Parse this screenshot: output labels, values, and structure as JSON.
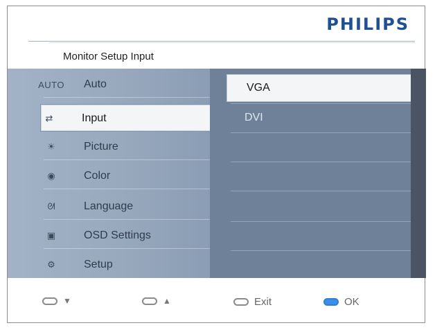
{
  "brand": "PHILIPS",
  "title": "Monitor Setup Input",
  "menu": {
    "items": [
      {
        "label": "Auto",
        "icon": "AUTO",
        "icon_name": "auto-icon"
      },
      {
        "label": "Input",
        "icon": "⇄",
        "icon_name": "input-icon",
        "selected": true
      },
      {
        "label": "Picture",
        "icon": "☀",
        "icon_name": "picture-icon"
      },
      {
        "label": "Color",
        "icon": "◉",
        "icon_name": "color-icon"
      },
      {
        "label": "Language",
        "icon": "ᘛ",
        "icon_name": "language-icon"
      },
      {
        "label": "OSD Settings",
        "icon": "▣",
        "icon_name": "osd-settings-icon"
      },
      {
        "label": "Setup",
        "icon": "⚙",
        "icon_name": "setup-icon"
      }
    ]
  },
  "submenu": {
    "items": [
      {
        "label": "VGA",
        "selected": true
      },
      {
        "label": "DVI"
      }
    ]
  },
  "footer": {
    "down": "▼",
    "up": "▲",
    "exit": "Exit",
    "ok": "OK"
  },
  "colors": {
    "brand": "#1f4f96",
    "menu_bg": "#6d8099",
    "ok_key": "#3b8fe6"
  }
}
